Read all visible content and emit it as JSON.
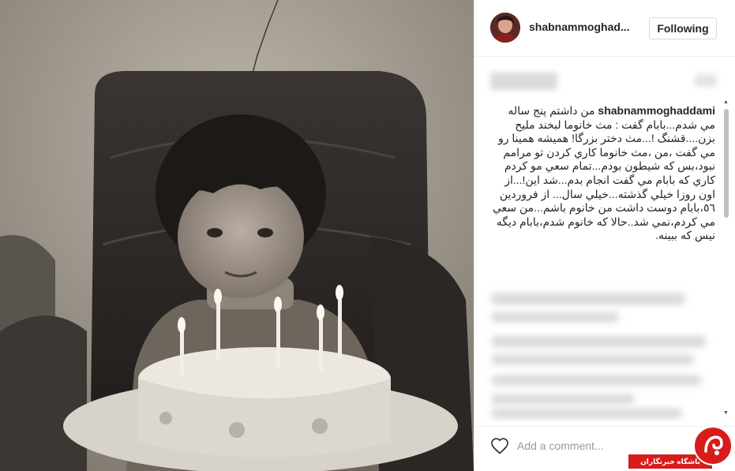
{
  "post": {
    "username": "shabnammoghad...",
    "follow_label": "Following",
    "caption_user": "shabnammoghaddami",
    "caption_text": "من داشتم پنج ساله مي شدم...بابام گفت : مث خانوما لبخند مليح بزن....قشنگ !...مث دختر بزرگا! هميشه همينا رو مي گفت ،من ،مث خانوما کاري کردن تو مرامم نبود،بس که شيطون بودم...تمام سعي مو کردم کاري که بابام مي گفت انجام بدم...شد اين!...از اون روزا خيلي گذشته...خيلي سال... از فروردين ٥٦،بابام دوست داشت من خانوم باشم...من سعي مي کردم،نمي شد..حالا که خانوم شدم،بابام ديگه نيس که ببينه.",
    "comment_placeholder": "Add a comment..."
  },
  "icons": {
    "heart": "heart-outline-icon",
    "avatar": "profile-avatar",
    "watermark_logo": "club-logo"
  },
  "watermark": {
    "text": "باشگاه خبرنگاران"
  },
  "colors": {
    "text": "#262626",
    "border": "#efefef",
    "placeholder": "#999999",
    "watermark_red": "#d81b1b",
    "photo_tone": "#958e85"
  }
}
